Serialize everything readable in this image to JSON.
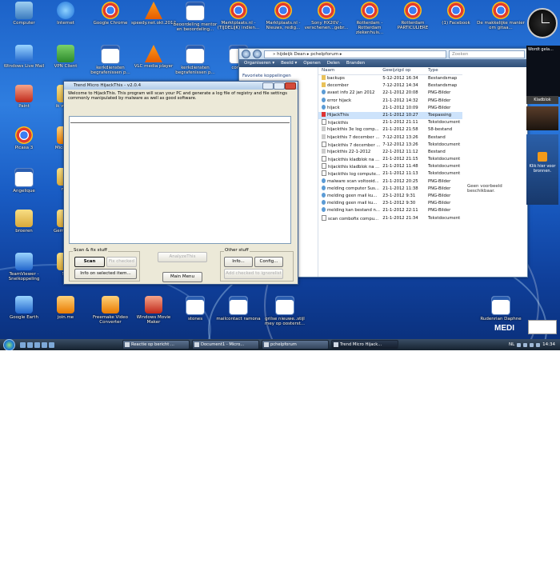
{
  "desktop_icons": [
    {
      "label": "Computer",
      "icon": "computer-icon",
      "x": 0,
      "y": 0
    },
    {
      "label": "Internet",
      "icon": "internet-explorer-icon"
    },
    {
      "label": "Google Chrome",
      "icon": "chrome-icon"
    },
    {
      "label": "speedy.net.okt.2012",
      "icon": "vlc-icon"
    },
    {
      "label": "beoordeling mentor en beoordeling...",
      "icon": "word-doc-icon"
    },
    {
      "label": "Marktplaats.nl - (TIJDELIJK) indien...",
      "icon": "chrome-icon"
    },
    {
      "label": "Marktplaats.nl - Nieuws, redig...",
      "icon": "chrome-icon"
    },
    {
      "label": "Sony HX20V - verschenen...gebr...",
      "icon": "chrome-icon"
    },
    {
      "label": "Rotterdam - Rotterdam ziekenhuis...",
      "icon": "chrome-icon"
    },
    {
      "label": "Rotterdam PARTICULIERE",
      "icon": "chrome-icon"
    },
    {
      "label": "(1) Facebook",
      "icon": "chrome-icon"
    },
    {
      "label": "De makkelijke manier om gitaa...",
      "icon": "chrome-icon"
    },
    {
      "label": "Windows Live Mail",
      "icon": "mail-icon"
    },
    {
      "label": "VPN Client",
      "icon": "vpn-icon"
    },
    {
      "label": "kerkdiensten begrafenissen p...",
      "icon": "document-icon"
    },
    {
      "label": "VLC media player",
      "icon": "vlc-icon"
    },
    {
      "label": "kerkdiensten begrafenissen p...",
      "icon": "document-icon"
    },
    {
      "label": "cont...",
      "icon": "document-icon"
    },
    {
      "label": "Paint",
      "icon": "paint-icon"
    },
    {
      "label": "ik wil b...",
      "icon": "folder-icon"
    },
    {
      "label": "Picasa 3",
      "icon": "picasa-icon"
    },
    {
      "label": "Microso...",
      "icon": "office-icon"
    },
    {
      "label": "Angelique",
      "icon": "word-doc-icon"
    },
    {
      "label": "m...",
      "icon": "folder-icon"
    },
    {
      "label": "broeren",
      "icon": "folder-icon"
    },
    {
      "label": "Gemist 2...",
      "icon": "folder-icon"
    },
    {
      "label": "TeamViewer - Snelkoppeling",
      "icon": "teamviewer-icon"
    },
    {
      "label": "S...",
      "icon": "folder-icon"
    },
    {
      "label": "Google Earth",
      "icon": "google-earth-icon"
    },
    {
      "label": "join.me",
      "icon": "joinme-icon"
    },
    {
      "label": "Freemake Video Converter",
      "icon": "freemake-icon"
    },
    {
      "label": "Windows Movie Maker",
      "icon": "movie-maker-icon"
    },
    {
      "label": "stones",
      "icon": "word-doc-icon"
    },
    {
      "label": "mailcontact ramona",
      "icon": "word-doc-icon"
    },
    {
      "label": "grilse nieuwe..stijl mey op oosterst...",
      "icon": "pdf-icon"
    },
    {
      "label": "Rudenrian Daphne",
      "icon": "document-icon"
    }
  ],
  "explorer": {
    "breadcrumb": "»  hijdeijk Dean  ▸  pchelpforum  ▸",
    "search_placeholder": "Zoeken",
    "toolbar": [
      "Organiseren ▾",
      "Beeld ▾",
      "Openen",
      "Delen",
      "Branden"
    ],
    "nav_heading": "Favoriete koppelingen",
    "columns": [
      "Naam",
      "Gewijzigd op",
      "Type"
    ],
    "files": [
      {
        "name": "backups",
        "date": "5-12-2012 16:34",
        "type": "Bestandsmap",
        "kind": "folder"
      },
      {
        "name": "december",
        "date": "7-12-2012 14:34",
        "type": "Bestandsmap",
        "kind": "folder"
      },
      {
        "name": "avast info 22 jan 2012",
        "date": "22-1-2012 20:08",
        "type": "PNG-Bilder",
        "kind": "png"
      },
      {
        "name": "error hijack",
        "date": "21-1-2012 14:32",
        "type": "PNG-Bilder",
        "kind": "png"
      },
      {
        "name": "hijack",
        "date": "21-1-2012 10:09",
        "type": "PNG-Bilder",
        "kind": "png"
      },
      {
        "name": "HijackThis",
        "date": "21-1-2012 10:27",
        "type": "Toepassing",
        "kind": "exe"
      },
      {
        "name": "hijackthis",
        "date": "21-1-2012 21:11",
        "type": "Tekstdocument",
        "kind": "txt"
      },
      {
        "name": "hijackthis 3e log comp...",
        "date": "21-1-2012 21:58",
        "type": "58-bestand",
        "kind": "file"
      },
      {
        "name": "hijackthis 7 december ...",
        "date": "7-12-2012 13:26",
        "type": "Bestand",
        "kind": "file"
      },
      {
        "name": "hijackthis 7 december ...",
        "date": "7-12-2012 13:26",
        "type": "Tekstdocument",
        "kind": "txt"
      },
      {
        "name": "hijackthis 22-1-2012",
        "date": "22-1-2012 11:12",
        "type": "Bestand",
        "kind": "file"
      },
      {
        "name": "hijackthis kladblok na ...",
        "date": "21-1-2012 21:15",
        "type": "Tekstdocument",
        "kind": "txt"
      },
      {
        "name": "hijackthis kladblok na ...",
        "date": "21-1-2012 11:48",
        "type": "Tekstdocument",
        "kind": "txt"
      },
      {
        "name": "hijackthis log compute...",
        "date": "21-1-2012 11:13",
        "type": "Tekstdocument",
        "kind": "txt"
      },
      {
        "name": "malware scan voltooid...",
        "date": "21-1-2012 20:25",
        "type": "PNG-Bilder",
        "kind": "png"
      },
      {
        "name": "melding computer Sus...",
        "date": "21-1-2012 11:38",
        "type": "PNG-Bilder",
        "kind": "png"
      },
      {
        "name": "melding geen mail ku...",
        "date": "23-1-2012 9:31",
        "type": "PNG-Bilder",
        "kind": "png"
      },
      {
        "name": "melding geen mail ku...",
        "date": "23-1-2012 9:30",
        "type": "PNG-Bilder",
        "kind": "png"
      },
      {
        "name": "melding kan bestand n...",
        "date": "21-1-2012 22:11",
        "type": "PNG-Bilder",
        "kind": "png"
      },
      {
        "name": "scan combofix compu...",
        "date": "21-1-2012 21:34",
        "type": "Tekstdocument",
        "kind": "txt"
      }
    ],
    "selected_index": 5,
    "preview_text": "Geen voorbeeld beschikbaar."
  },
  "hijackthis": {
    "title": "Trend Micro HijackThis - v2.0.4",
    "intro": "Welcome to HijackThis. This program will scan your PC and generate a log file of registry and file settings commonly manipulated by malware as well as good software.",
    "scan_group": "Scan & fix stuff",
    "other_group": "Other stuff",
    "scan_button": "Scan",
    "fix_checked_button": "Fix checked",
    "info_selected_button": "Info on selected item...",
    "analyze_button": "AnalyzeThis",
    "main_menu_button": "Main Menu",
    "info_button": "Info...",
    "config_button": "Config...",
    "add_ignore_button": "Add checked to ignorelist"
  },
  "sidebar": {
    "gadget1": "Wordt gela...",
    "gadget2": "Kladblok",
    "gadget3": "Klik hier voor bronnen."
  },
  "taskbar": {
    "tasks": [
      "Reactie op bericht ...",
      "Document1 - Micro...",
      "pchelpforum",
      "Trend Micro Hijack..."
    ],
    "active_index": 3,
    "lang": "NL",
    "clock": "14:34"
  },
  "brand_text": "MEDI",
  "colors": {
    "accent": "#1c62c8",
    "taskbar": "#16222f",
    "selection": "#cde3fb"
  }
}
